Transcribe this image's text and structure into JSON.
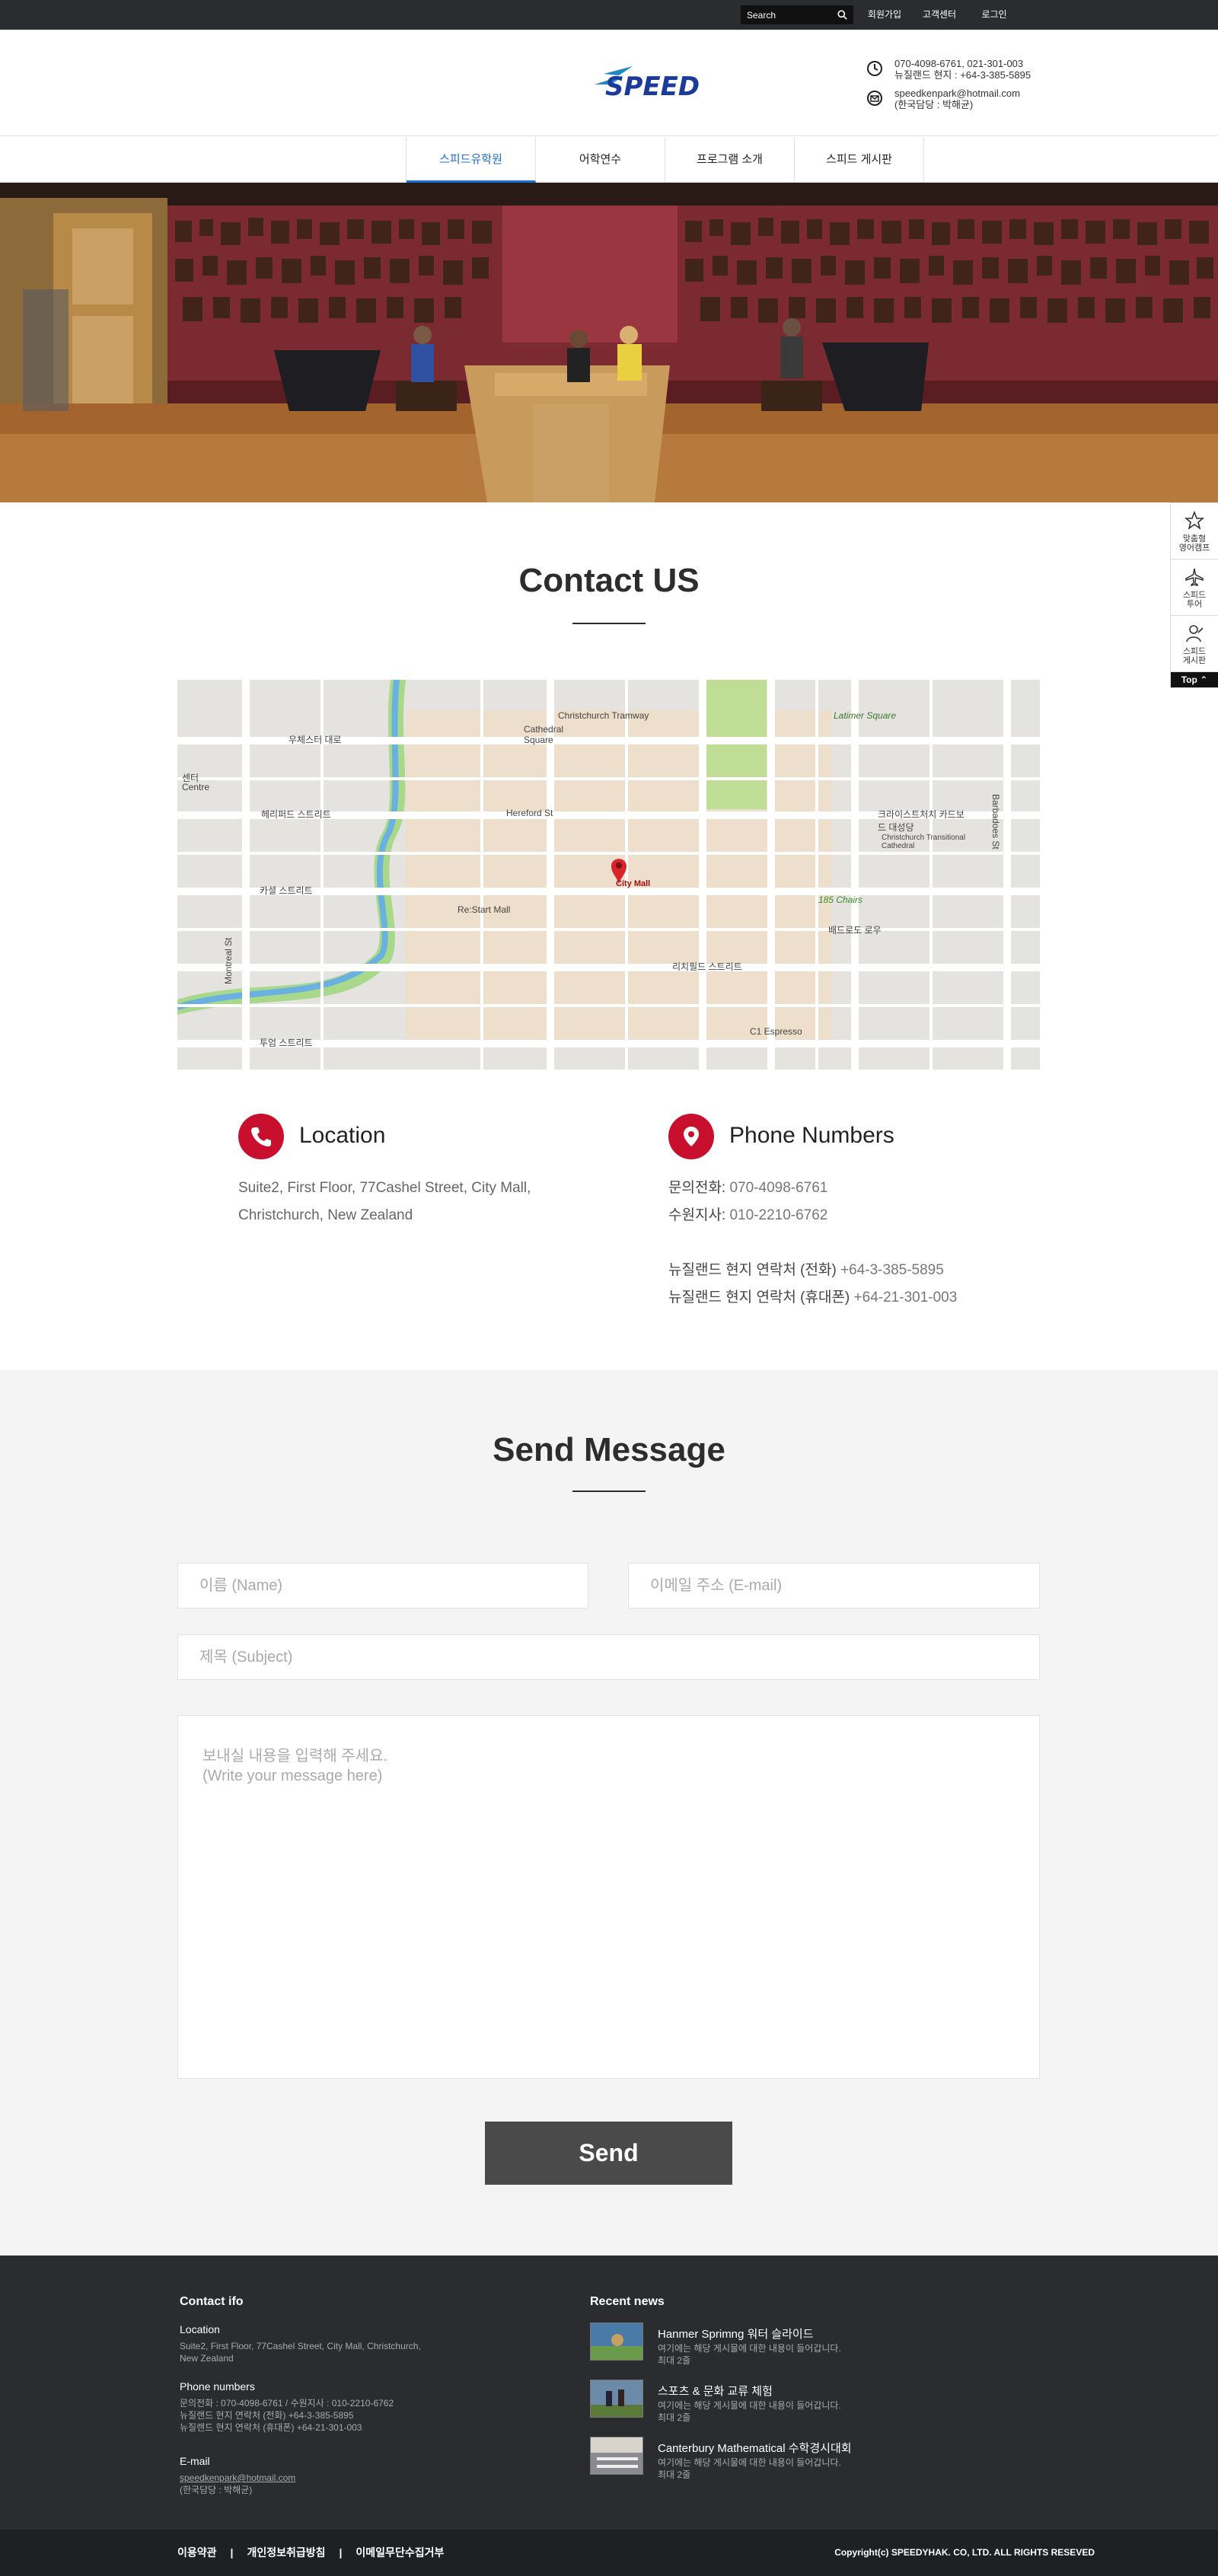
{
  "topbar": {
    "search_placeholder": "Search",
    "links": [
      "회원가입",
      "고객센터",
      "로그인"
    ]
  },
  "header": {
    "logo_text": "SPEED",
    "phone_line1": "070-4098-6761, 021-301-003",
    "phone_line2": "뉴질랜드 현지 : +64-3-385-5895",
    "email_line1": "speedkenpark@hotmail.com",
    "email_line2": "(한국담당 : 박해균)"
  },
  "nav": {
    "items": [
      "스피드유학원",
      "어학연수",
      "프로그램 소개",
      "스피드 게시판"
    ]
  },
  "quick_menu": {
    "items": [
      "맞춤형\n영어캠프",
      "스피드\n투어",
      "스피드\n게시판"
    ],
    "top_label": "Top"
  },
  "contact": {
    "title": "Contact US"
  },
  "map": {
    "labels": [
      "Christchurch Tramway",
      "Cathedral Square",
      "Latimer Square",
      "Hereford St",
      "City Mall",
      "Re:Start Mall",
      "크라이스트처치 카드보드 대성당",
      "Christchurch Transitional Cathedral",
      "185 Chairs",
      "C1 Espresso",
      "우체스터 대로",
      "헤리퍼드 스트리트",
      "카셜 스트리트",
      "리치필드 스트리트",
      "투엄 스트리트",
      "배드로도 로우",
      "Montreal St",
      "Barbadoes St",
      "센터",
      "Centre"
    ]
  },
  "location": {
    "title": "Location",
    "line1": "Suite2, First Floor, 77Cashel Street, City Mall,",
    "line2": "Christchurch, New Zealand"
  },
  "phones": {
    "title": "Phone Numbers",
    "line1_label": "문의전화:",
    "line1_value": "070-4098-6761",
    "line2_label": "수원지사:",
    "line2_value": "010-2210-6762",
    "line3_label": "뉴질랜드 현지 연락처 (전화)",
    "line3_value": "+64-3-385-5895",
    "line4_label": "뉴질랜드 현지 연락처 (휴대폰)",
    "line4_value": "+64-21-301-003"
  },
  "message": {
    "title": "Send Message",
    "name_placeholder": "이름 (Name)",
    "email_placeholder": "이메일 주소 (E-mail)",
    "subject_placeholder": "제목 (Subject)",
    "message_placeholder": "보내실 내용을 입력해 주세요.\n(Write your message here)",
    "send_label": "Send"
  },
  "footer": {
    "contact_title": "Contact ifo",
    "location_label": "Location",
    "location_line1": "Suite2, First Floor, 77Cashel Street, City Mall, Christchurch,",
    "location_line2": "New Zealand",
    "phone_label": "Phone numbers",
    "phone_line1": "문의전화 : 070-4098-6761 / 수원지사 : 010-2210-6762",
    "phone_line2": "뉴질랜드 현지 연락처 (전화) +64-3-385-5895",
    "phone_line3": "뉴질랜드 현지 연락처 (휴대폰) +64-21-301-003",
    "email_label": "E-mail",
    "email_line1": "speedkenpark@hotmail.com",
    "email_line2": "(한국담당 : 박해균)",
    "news_title": "Recent news",
    "news": [
      {
        "title": "Hanmer Sprimng 워터 슬라이드",
        "desc1": "여기에는 해당 게시물에 대한 내용이 들어갑니다.",
        "desc2": "최대 2줄"
      },
      {
        "title": "스포츠 & 문화 교류 체험",
        "desc1": "여기에는 해당 게시물에 대한 내용이 들어갑니다.",
        "desc2": "최대 2줄"
      },
      {
        "title": "Canterbury Mathematical 수학경시대회",
        "desc1": "여기에는 해당 게시물에 대한 내용이 들어갑니다.",
        "desc2": "최대 2줄"
      }
    ],
    "bottom_links": [
      "이용약관",
      "개인정보취급방침",
      "이메일무단수집거부"
    ],
    "copyright": "Copyright(c) SPEEDYHAK. CO, LTD. ALL RIGHTS RESEVED"
  },
  "colors": {
    "accent_red": "#c8102e",
    "nav_active": "#1a6fd6",
    "dark_bar": "#2a2c30"
  }
}
